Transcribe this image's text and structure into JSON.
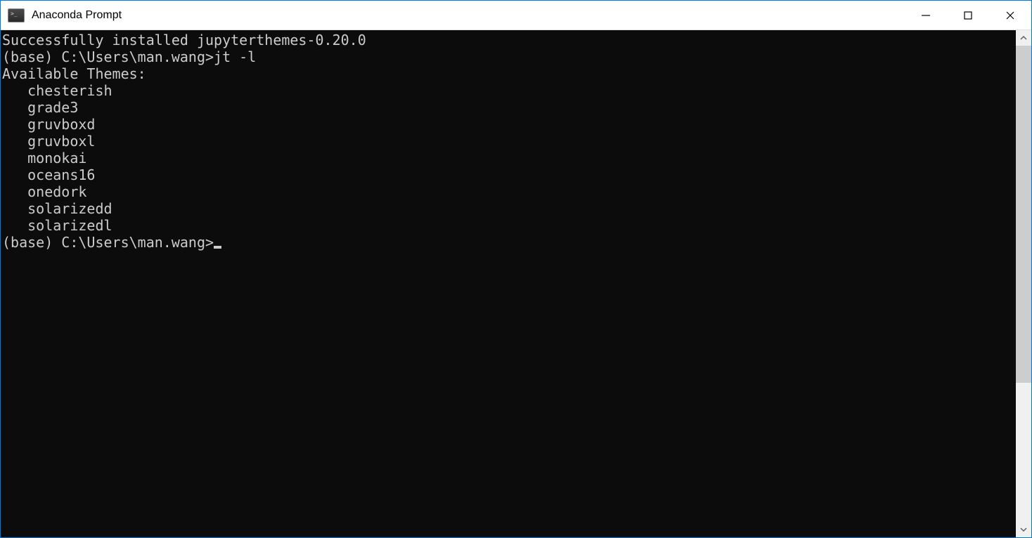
{
  "window": {
    "title": "Anaconda Prompt"
  },
  "terminal": {
    "lines": [
      "Successfully installed jupyterthemes-0.20.0",
      "",
      "(base) C:\\Users\\man.wang>jt -l",
      "Available Themes: ",
      "   chesterish",
      "   grade3",
      "   gruvboxd",
      "   gruvboxl",
      "   monokai",
      "   oceans16",
      "   onedork",
      "   solarizedd",
      "   solarizedl",
      ""
    ],
    "current_prompt": "(base) C:\\Users\\man.wang>"
  }
}
